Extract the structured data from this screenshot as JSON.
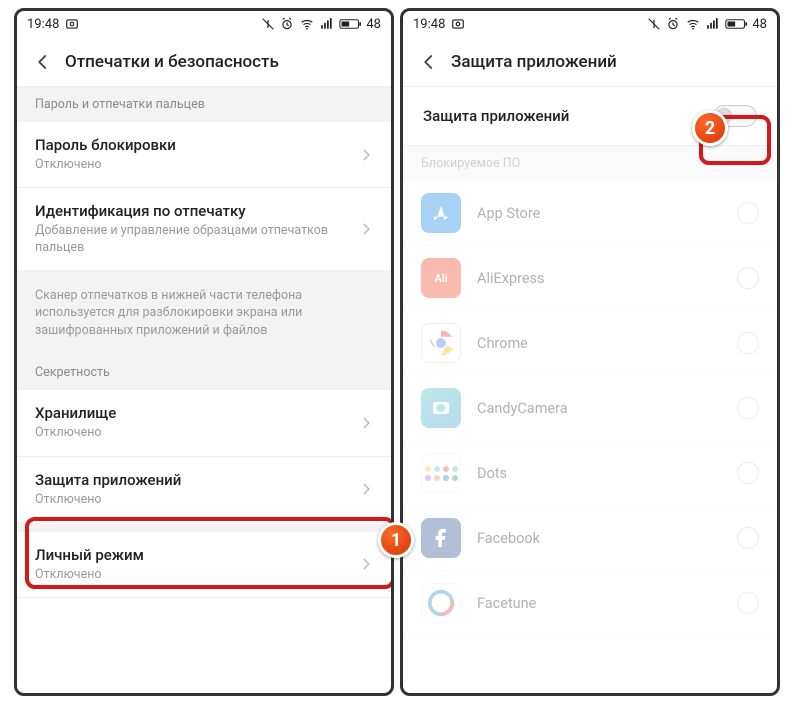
{
  "status": {
    "time": "19:48",
    "battery": "48"
  },
  "left": {
    "header_title": "Отпечатки и безопасность",
    "section_password": "Пароль и отпечатки пальцев",
    "row_lock": {
      "title": "Пароль блокировки",
      "sub": "Отключено"
    },
    "row_fp": {
      "title": "Идентификация по отпечатку",
      "sub": "Добавление и управление образцами отпечатков пальцев"
    },
    "info_scanner": "Сканер отпечатков в нижней части телефона используется для разблокировки экрана или зашифрованных приложений и файлов",
    "section_privacy": "Секретность",
    "row_storage": {
      "title": "Хранилище",
      "sub": "Отключено"
    },
    "row_appprotect": {
      "title": "Защита приложений",
      "sub": "Отключено"
    },
    "row_personal": {
      "title": "Личный режим",
      "sub": "Отключено"
    }
  },
  "right": {
    "header_title": "Защита приложений",
    "toggle_label": "Защита приложений",
    "section_blocked": "Блокируемое ПО",
    "apps": [
      {
        "name": "App Store",
        "icon": "appstore"
      },
      {
        "name": "AliExpress",
        "icon": "ali"
      },
      {
        "name": "Chrome",
        "icon": "chrome"
      },
      {
        "name": "CandyCamera",
        "icon": "candy"
      },
      {
        "name": "Dots",
        "icon": "dots"
      },
      {
        "name": "Facebook",
        "icon": "fb"
      },
      {
        "name": "Facetune",
        "icon": "facetune"
      }
    ]
  },
  "callouts": {
    "one": "1",
    "two": "2"
  }
}
